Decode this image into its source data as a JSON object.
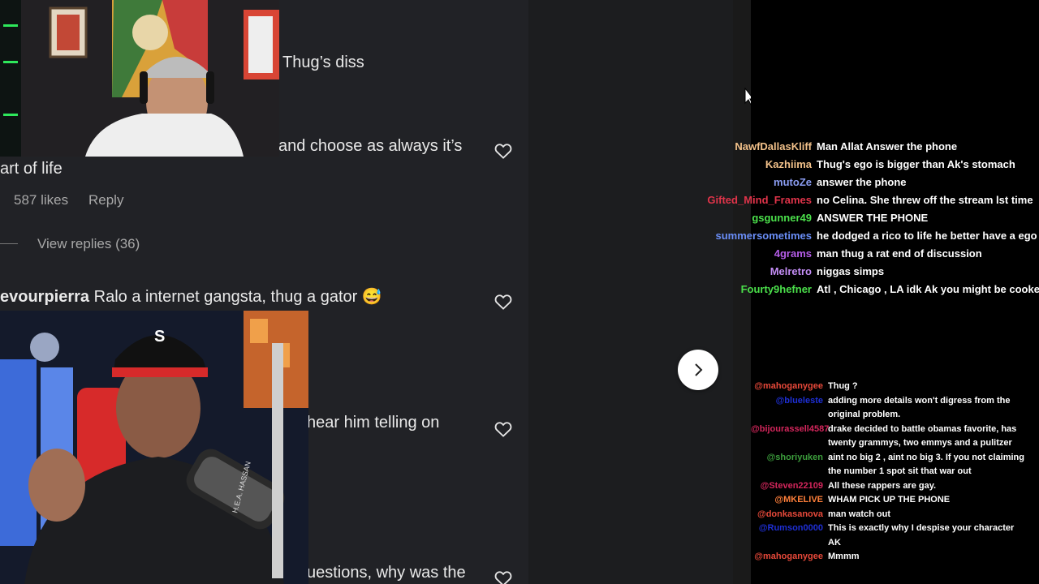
{
  "comments": [
    {
      "text": "Thug’s diss"
    },
    {
      "text_line1": "and choose as always it’s",
      "text_line2": "art of life",
      "likes": "587 likes",
      "reply": "Reply",
      "view_replies": "View replies (36)"
    },
    {
      "username": "evourpierra",
      "text": "Ralo a internet gangsta, thug a gator",
      "emoji": "😅"
    },
    {
      "text": "hear him telling on"
    },
    {
      "text": "uestions, why was the"
    }
  ],
  "chat_top": [
    {
      "user": "NawfDallasKliff",
      "color": "#f2c18a",
      "message": "Man Allat Answer the phone"
    },
    {
      "user": "Kazhiima",
      "color": "#f2c18a",
      "message": "Thug's ego is bigger than Ak's stomach"
    },
    {
      "user": "mutoZe",
      "color": "#8b9df2",
      "message": "answer the phone"
    },
    {
      "user": "Gifted_Mind_Frames",
      "color": "#e0344a",
      "message": "no Celina. She threw off the stream lst time"
    },
    {
      "user": "gsgunner49",
      "color": "#4be04b",
      "message": "ANSWER THE PHONE"
    },
    {
      "user": "summersometimes",
      "color": "#6a8ef7",
      "message": "he dodged a rico to life he better have a ego"
    },
    {
      "user": "4grams",
      "color": "#b55de8",
      "message": "man thug a rat end of discussion"
    },
    {
      "user": "Melretro",
      "color": "#c38df5",
      "message": "niggas simps"
    },
    {
      "user": "Fourty9hefner",
      "color": "#4be04b",
      "message": "Atl , Chicago , LA idk Ak you might be cooked"
    }
  ],
  "chat_bottom": [
    {
      "user": "@mahoganygee",
      "color": "#e8493a",
      "message": "Thug ?"
    },
    {
      "user": "@blueleste",
      "color": "#1e2fd6",
      "message": "adding more details won't digress from the original problem."
    },
    {
      "user": "@bijourassell4587",
      "color": "#d4265c",
      "message": "drake decided to battle obamas favorite, has twenty grammys, two emmys and a pulitzer"
    },
    {
      "user": "@shoriyuken",
      "color": "#3c9e3c",
      "message": "aint no big 2 , aint no big 3. If you not claiming the number 1 spot sit that war out"
    },
    {
      "user": "@Steven22109",
      "color": "#d4265c",
      "message": "All these rappers are gay."
    },
    {
      "user": "@MKELIVE",
      "color": "#ff7f3a",
      "message": "WHAM PICK UP THE PHONE"
    },
    {
      "user": "@donkasanova",
      "color": "#e8493a",
      "message": "man watch out"
    },
    {
      "user": "@Rumson0000",
      "color": "#1e2fd6",
      "message": "This is exactly why I despise your character AK"
    },
    {
      "user": "@mahoganygee",
      "color": "#e8493a",
      "message": "Mmmm"
    }
  ],
  "webcam1": {
    "label": "streamer-webcam"
  },
  "webcam2": {
    "label": "guest-webcam",
    "mic_text": "H.E.A. HASSAN"
  },
  "colors": {
    "panel_bg": "#212226",
    "accent_white": "#ffffff"
  }
}
